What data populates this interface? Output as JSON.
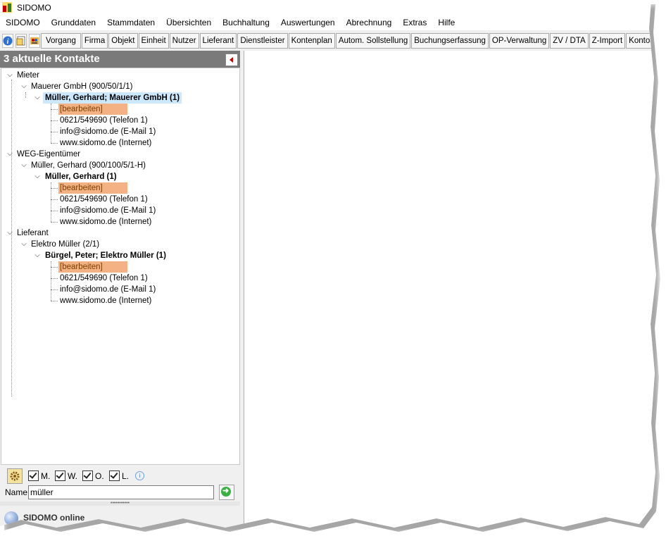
{
  "window": {
    "title": "SIDOMO"
  },
  "menu": [
    "SIDOMO",
    "Grunddaten",
    "Stammdaten",
    "Übersichten",
    "Buchhaltung",
    "Auswertungen",
    "Abrechnung",
    "Extras",
    "Hilfe"
  ],
  "toolbar": {
    "group1": [
      "Vorgang"
    ],
    "group2": [
      "Firma",
      "Objekt",
      "Einheit",
      "Nutzer",
      "Lieferant",
      "Dienstleister"
    ],
    "group3": [
      "Kontenplan",
      "Autom. Sollstellung",
      "Buchungserfassung",
      "OP-Verwaltung",
      "ZV / DTA",
      "Z-Import"
    ],
    "group4": [
      "Kontoauszug"
    ]
  },
  "panel": {
    "title": "3 aktuelle Kontakte"
  },
  "tree": {
    "groups": [
      {
        "label": "Mieter",
        "child": "Mauerer GmbH (900/50/1/1)",
        "contact": "Müller, Gerhard; Mauerer GmbH (1)",
        "details": [
          "[bearbeiten]",
          "0621/549690 (Telefon 1)",
          "info@sidomo.de (E-Mail 1)",
          "www.sidomo.de (Internet)"
        ]
      },
      {
        "label": "WEG-Eigentümer",
        "child": "Müller, Gerhard (900/100/5/1-H)",
        "contact": "Müller, Gerhard (1)",
        "details": [
          "[bearbeiten]",
          "0621/549690 (Telefon 1)",
          "info@sidomo.de (E-Mail 1)",
          "www.sidomo.de (Internet)"
        ]
      },
      {
        "label": "Lieferant",
        "child": "Elektro Müller (2/1)",
        "contact": "Bürgel, Peter; Elektro Müller (1)",
        "details": [
          "[bearbeiten]",
          "0621/549690 (Telefon 1)",
          "info@sidomo.de (E-Mail 1)",
          "www.sidomo.de (Internet)"
        ]
      }
    ]
  },
  "filters": {
    "checkboxes": [
      {
        "label": "M.",
        "checked": true
      },
      {
        "label": "W.",
        "checked": true
      },
      {
        "label": "O.",
        "checked": true
      },
      {
        "label": "L.",
        "checked": true
      }
    ],
    "name_label": "Name:",
    "name_value": "müller"
  },
  "footer": {
    "online_label": "SIDOMO online"
  },
  "colors": {
    "panel_header": "#7a7a7a",
    "edit_highlight": "#f4b183",
    "selection": "#cce8ff"
  }
}
